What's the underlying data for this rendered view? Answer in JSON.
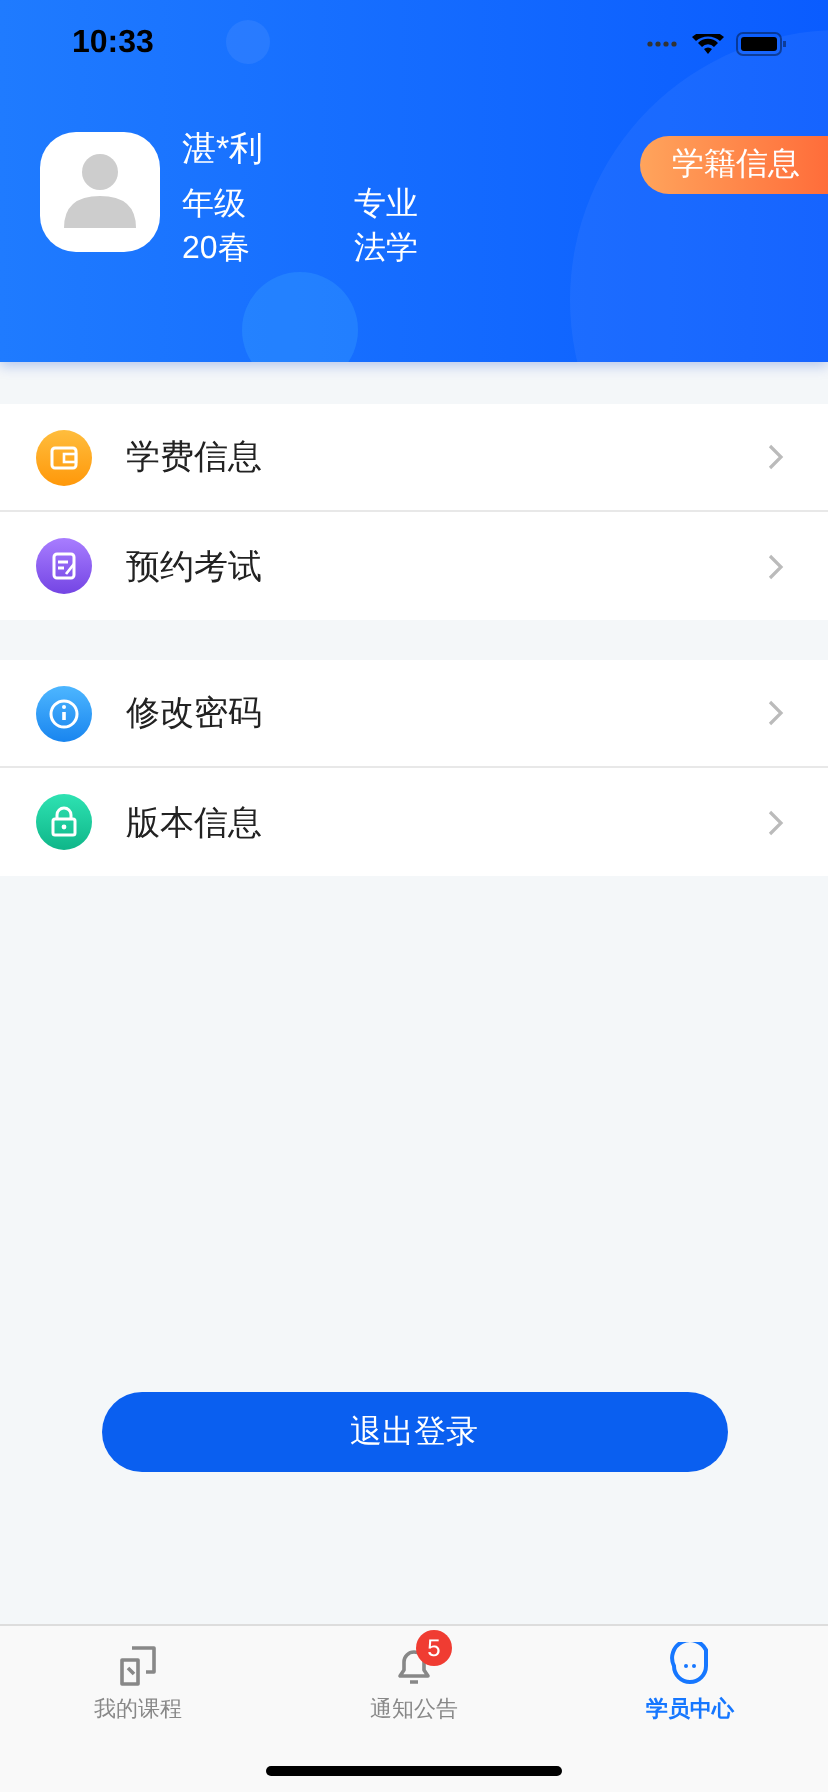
{
  "status_bar": {
    "time": "10:33"
  },
  "profile": {
    "name": "湛*利",
    "fields": [
      {
        "label": "年级",
        "value": "20春"
      },
      {
        "label": "专业",
        "value": "法学"
      }
    ],
    "badge": "学籍信息"
  },
  "menu_groups": [
    [
      {
        "label": "学费信息",
        "kind": "wallet"
      },
      {
        "label": "预约考试",
        "kind": "edit"
      }
    ],
    [
      {
        "label": "修改密码",
        "kind": "info"
      },
      {
        "label": "版本信息",
        "kind": "lock"
      }
    ]
  ],
  "logout_button": "退出登录",
  "tabs": [
    {
      "label": "我的课程",
      "kind": "course",
      "selected": false
    },
    {
      "label": "通知公告",
      "kind": "bell",
      "selected": false,
      "badge": "5"
    },
    {
      "label": "学员中心",
      "kind": "face",
      "selected": true
    }
  ]
}
